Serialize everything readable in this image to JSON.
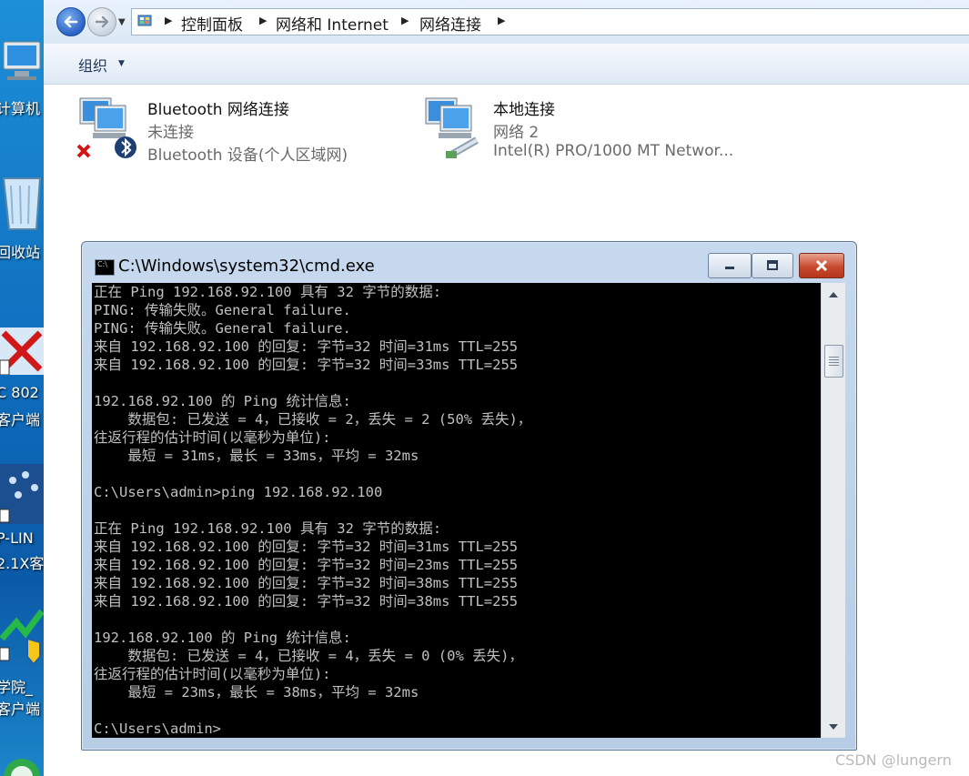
{
  "desktop": {
    "icons": [
      {
        "label": "计算机",
        "icon": "computer-icon"
      },
      {
        "label": "回收站",
        "icon": "recycle-bin-icon"
      },
      {
        "label": "C 802",
        "icon": "h3c-client-icon"
      },
      {
        "label": "客户端",
        "icon": ""
      },
      {
        "label": "P-LIN",
        "icon": "tplink-icon"
      },
      {
        "label": "2.1X客",
        "icon": ""
      },
      {
        "label": "学院_",
        "icon": "campus-client-icon"
      },
      {
        "label": "客户端",
        "icon": ""
      }
    ]
  },
  "explorer": {
    "breadcrumb": [
      "控制面板",
      "网络和 Internet",
      "网络连接"
    ],
    "toolbar": {
      "organize_label": "组织"
    },
    "connections": [
      {
        "name": "Bluetooth 网络连接",
        "status": "未连接",
        "device": "Bluetooth 设备(个人区域网)",
        "icon": "bluetooth-network-icon"
      },
      {
        "name": "本地连接",
        "status": "网络  2",
        "device": "Intel(R) PRO/1000 MT Networ...",
        "icon": "ethernet-network-icon"
      }
    ]
  },
  "cmd": {
    "title": "C:\\Windows\\system32\\cmd.exe",
    "lines": [
      "正在 Ping 192.168.92.100 具有 32 字节的数据:",
      "PING: 传输失败。General failure.",
      "PING: 传输失败。General failure.",
      "来自 192.168.92.100 的回复: 字节=32 时间=31ms TTL=255",
      "来自 192.168.92.100 的回复: 字节=32 时间=33ms TTL=255",
      "",
      "192.168.92.100 的 Ping 统计信息:",
      "    数据包: 已发送 = 4，已接收 = 2，丢失 = 2 (50% 丢失)，",
      "往返行程的估计时间(以毫秒为单位):",
      "    最短 = 31ms，最长 = 33ms，平均 = 32ms",
      "",
      "C:\\Users\\admin>ping 192.168.92.100",
      "",
      "正在 Ping 192.168.92.100 具有 32 字节的数据:",
      "来自 192.168.92.100 的回复: 字节=32 时间=31ms TTL=255",
      "来自 192.168.92.100 的回复: 字节=32 时间=23ms TTL=255",
      "来自 192.168.92.100 的回复: 字节=32 时间=38ms TTL=255",
      "来自 192.168.92.100 的回复: 字节=32 时间=38ms TTL=255",
      "",
      "192.168.92.100 的 Ping 统计信息:",
      "    数据包: 已发送 = 4，已接收 = 4，丢失 = 0 (0% 丢失)，",
      "往返行程的估计时间(以毫秒为单位):",
      "    最短 = 23ms，最长 = 38ms，平均 = 32ms",
      "",
      "C:\\Users\\admin>"
    ]
  },
  "watermark": "CSDN @lungern",
  "colors": {
    "console_bg": "#000000",
    "console_fg": "#c0c0c0",
    "title_bar": "#b7cde6",
    "close_btn": "#c74a2f"
  }
}
